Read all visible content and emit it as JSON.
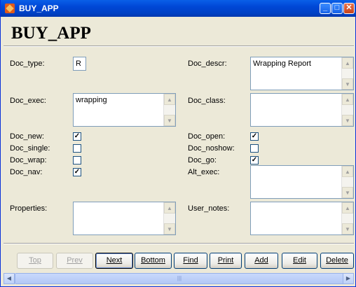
{
  "window": {
    "title": "BUY_APP",
    "minimize": "_",
    "maximize": "□",
    "close": "✕"
  },
  "heading": "BUY_APP",
  "left": {
    "doc_type_label": "Doc_type:",
    "doc_type_value": "R",
    "doc_exec_label": "Doc_exec:",
    "doc_exec_value": "wrapping",
    "doc_new_label": "Doc_new:",
    "doc_new_checked": true,
    "doc_single_label": "Doc_single:",
    "doc_single_checked": false,
    "doc_wrap_label": "Doc_wrap:",
    "doc_wrap_checked": false,
    "doc_nav_label": "Doc_nav:",
    "doc_nav_checked": true,
    "properties_label": "Properties:",
    "properties_value": ""
  },
  "right": {
    "doc_descr_label": "Doc_descr:",
    "doc_descr_value": "Wrapping Report",
    "doc_class_label": "Doc_class:",
    "doc_class_value": "",
    "doc_open_label": "Doc_open:",
    "doc_open_checked": true,
    "doc_noshow_label": "Doc_noshow:",
    "doc_noshow_checked": false,
    "doc_go_label": "Doc_go:",
    "doc_go_checked": true,
    "alt_exec_label": "Alt_exec:",
    "alt_exec_value": "",
    "user_notes_label": "User_notes:",
    "user_notes_value": ""
  },
  "buttons": {
    "top": "Top",
    "prev": "Prev",
    "next": "Next",
    "bottom": "Bottom",
    "find": "Find",
    "print": "Print",
    "add": "Add",
    "edit": "Edit",
    "delete": "Delete"
  },
  "glyphs": {
    "check": "✓",
    "up": "▲",
    "down": "▼",
    "left": "◀",
    "right": "▶",
    "grip": "|||"
  }
}
